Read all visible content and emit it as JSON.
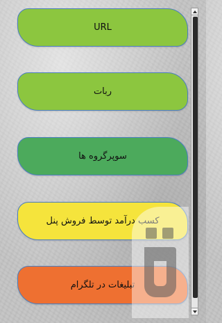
{
  "menu": {
    "items": [
      {
        "label": "URL",
        "color": "#8cc63f"
      },
      {
        "label": "ربات",
        "color": "#8cc63f"
      },
      {
        "label": "سوپرگروه ها",
        "color": "#4caa5c"
      },
      {
        "label": "کسب درآمد توسط فروش پنل",
        "color": "#f5e43c"
      },
      {
        "label": "تبلیغات در تلگرام",
        "color": "#ee7031"
      }
    ]
  },
  "scrollbar": {
    "position": 0.0,
    "visible_fraction": 0.97
  },
  "icons": {
    "scroll_up": "arrow-up-icon",
    "scroll_down": "arrow-down-icon",
    "watermark": "watermark-logo-icon"
  }
}
